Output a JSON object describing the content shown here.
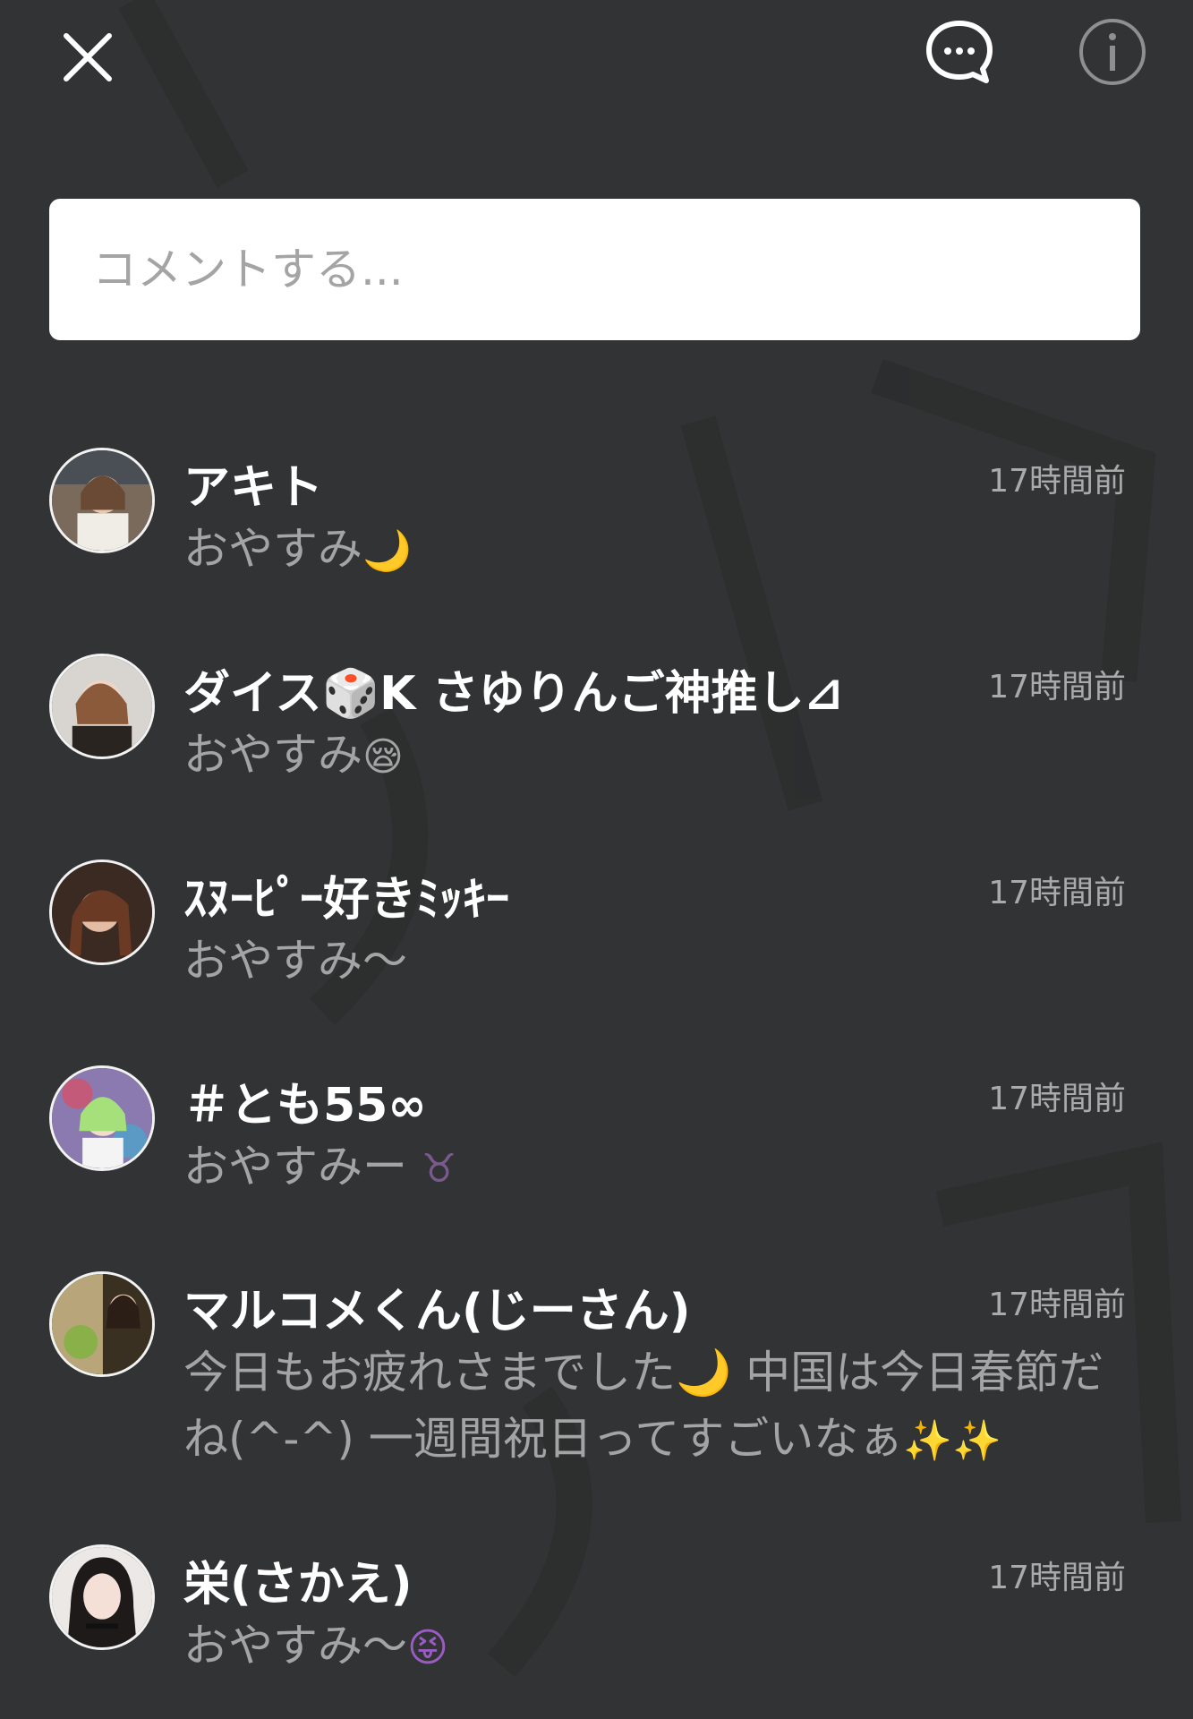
{
  "header": {
    "close_icon": "close-icon",
    "comments_icon": "chat-bubble-ellipsis-icon",
    "info_icon": "info-icon"
  },
  "comment_input": {
    "placeholder": "コメントする..."
  },
  "comments": [
    {
      "name": "アキト",
      "time": "17時間前",
      "text": "おやすみ",
      "emoji": "🌙",
      "emoji_color": "#d9a030"
    },
    {
      "name": "ダイス🎲K さゆりんご神推し⊿",
      "time": "17時間前",
      "text": "おやすみ",
      "emoji": "😪",
      "emoji_color": "#e0b640"
    },
    {
      "name": "ｽﾇｰﾋﾟｰ好きﾐｯｷｰ",
      "time": "17時間前",
      "text": "おやすみ〜",
      "emoji": "",
      "emoji_color": ""
    },
    {
      "name": "＃とも55∞",
      "time": "17時間前",
      "text": "おやすみー",
      "emoji": "♉",
      "emoji_color": "#7a5a8c"
    },
    {
      "name": "マルコメくん(じーさん)",
      "time": "17時間前",
      "text": "今日もお疲れさまでした🌙 中国は今日春節だね(^-^) 一週間祝日ってすごいなぁ",
      "emoji": "✨✨",
      "emoji_color": "#c49a3a"
    },
    {
      "name": "栄(さかえ)",
      "time": "17時間前",
      "text": "おやすみ〜",
      "emoji": "😝",
      "emoji_color": "#9a5cc4"
    }
  ],
  "colors": {
    "background": "#323334",
    "name": "#ffffff",
    "message": "#a3a4a5",
    "timestamp": "#a9aaab"
  }
}
